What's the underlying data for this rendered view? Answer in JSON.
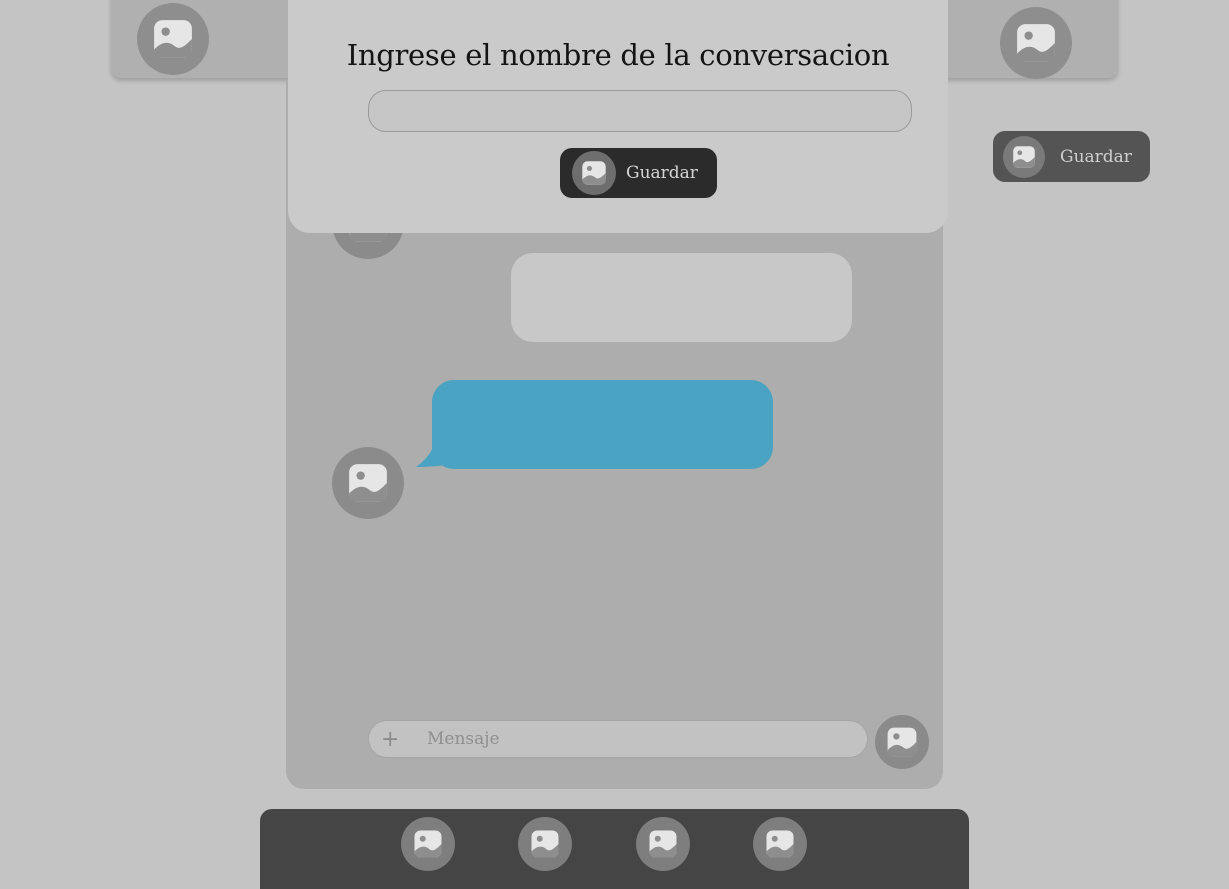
{
  "header": {
    "left_icon": "image-placeholder-icon",
    "right_icon": "image-placeholder-icon"
  },
  "side_save": {
    "label": "Guardar",
    "icon": "image-placeholder-icon"
  },
  "modal": {
    "title": "Ingrese el nombre de la conversacion",
    "input_value": "",
    "save_label": "Guardar",
    "save_icon": "image-placeholder-icon"
  },
  "chat": {
    "messages": [
      {
        "side": "right",
        "text": "",
        "color": "#c8c8c8"
      },
      {
        "side": "left",
        "text": "",
        "color": "#4aa3c2"
      }
    ],
    "composer": {
      "add_symbol": "+",
      "placeholder": "Mensaje"
    }
  },
  "bottom_nav": {
    "items": [
      {
        "icon": "image-placeholder-icon"
      },
      {
        "icon": "image-placeholder-icon"
      },
      {
        "icon": "image-placeholder-icon"
      },
      {
        "icon": "image-placeholder-icon"
      }
    ]
  },
  "colors": {
    "background": "#c4c4c4",
    "chat_panel": "#adadad",
    "accent_bubble": "#4aa3c2",
    "dark_button": "#2b2b2b",
    "bottom_nav": "#454545"
  }
}
